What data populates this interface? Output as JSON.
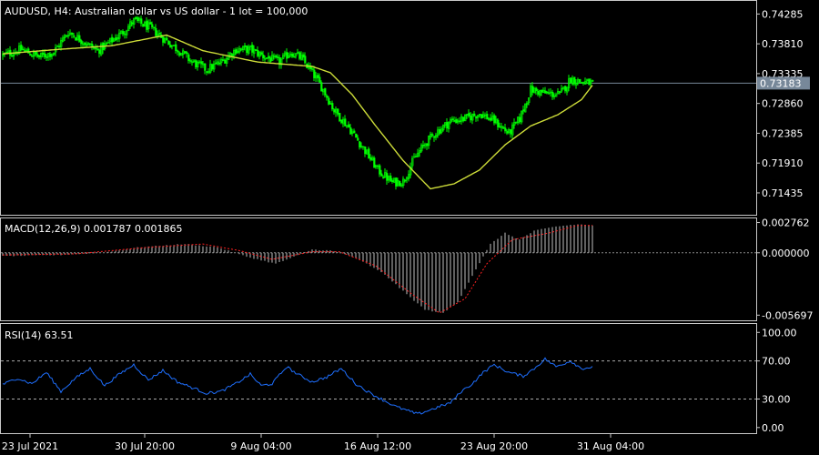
{
  "symbol_info": "AUDUSD, H4:  Australian dollar vs US dollar - 1 lot = 100,000",
  "colors": {
    "background": "#000000",
    "candles": "#00ff00",
    "moving_average": "#cddc39",
    "grid_border": "#c8c8c8",
    "price_line": "#778899",
    "macd_histogram": "#c0c0c0",
    "macd_signal": "#ff2020",
    "rsi_line": "#1e6fff",
    "text": "#ffffff"
  },
  "chart_data": [
    {
      "type": "candlestick",
      "title": "AUDUSD, H4:  Australian dollar vs US dollar - 1 lot = 100,000",
      "ylim": [
        0.7113,
        0.7445
      ],
      "y_ticks": [
        "0.74285",
        "0.73810",
        "0.73335",
        "0.72860",
        "0.72385",
        "0.71910",
        "0.71435"
      ],
      "y_tick_values": [
        0.74285,
        0.7381,
        0.73335,
        0.7286,
        0.72385,
        0.7191,
        0.71435
      ],
      "current_price_label": "0.73183",
      "current_price": 0.73183,
      "close_anchors": [
        [
          0,
          0.7363
        ],
        [
          10,
          0.7372
        ],
        [
          20,
          0.736
        ],
        [
          28,
          0.7368
        ],
        [
          36,
          0.74
        ],
        [
          44,
          0.7385
        ],
        [
          52,
          0.737
        ],
        [
          58,
          0.7382
        ],
        [
          66,
          0.74
        ],
        [
          72,
          0.7418
        ],
        [
          80,
          0.7408
        ],
        [
          88,
          0.739
        ],
        [
          96,
          0.7372
        ],
        [
          104,
          0.7352
        ],
        [
          112,
          0.734
        ],
        [
          120,
          0.7352
        ],
        [
          128,
          0.7372
        ],
        [
          136,
          0.7372
        ],
        [
          144,
          0.736
        ],
        [
          152,
          0.7352
        ],
        [
          158,
          0.7368
        ],
        [
          164,
          0.7358
        ],
        [
          170,
          0.7335
        ],
        [
          176,
          0.7308
        ],
        [
          182,
          0.7275
        ],
        [
          190,
          0.7248
        ],
        [
          198,
          0.7215
        ],
        [
          206,
          0.718
        ],
        [
          214,
          0.716
        ],
        [
          220,
          0.7162
        ],
        [
          226,
          0.7198
        ],
        [
          232,
          0.7222
        ],
        [
          238,
          0.724
        ],
        [
          246,
          0.7258
        ],
        [
          254,
          0.7262
        ],
        [
          262,
          0.727
        ],
        [
          270,
          0.7258
        ],
        [
          278,
          0.7238
        ],
        [
          284,
          0.7262
        ],
        [
          290,
          0.7308
        ],
        [
          298,
          0.7302
        ],
        [
          306,
          0.73
        ],
        [
          312,
          0.7325
        ],
        [
          318,
          0.732
        ],
        [
          324,
          0.7318
        ]
      ],
      "ma_anchors": [
        [
          0,
          0.7365
        ],
        [
          30,
          0.7372
        ],
        [
          60,
          0.7378
        ],
        [
          90,
          0.7395
        ],
        [
          110,
          0.737
        ],
        [
          140,
          0.7352
        ],
        [
          170,
          0.7345
        ],
        [
          180,
          0.7335
        ],
        [
          192,
          0.73
        ],
        [
          205,
          0.725
        ],
        [
          220,
          0.7195
        ],
        [
          235,
          0.715
        ],
        [
          248,
          0.7158
        ],
        [
          262,
          0.718
        ],
        [
          276,
          0.722
        ],
        [
          290,
          0.725
        ],
        [
          305,
          0.7268
        ],
        [
          318,
          0.7292
        ],
        [
          324,
          0.7315
        ]
      ],
      "bars": 325,
      "x_tick_labels": [
        "23 Jul 2021",
        "30 Jul 20:00",
        "9 Aug 04:00",
        "16 Aug 12:00",
        "23 Aug 20:00",
        "31 Aug 04:00"
      ],
      "x_tick_bars": [
        15,
        78,
        142,
        206,
        270,
        334
      ]
    },
    {
      "type": "bar",
      "title": "MACD(12,26,9) 0.001787 0.001865",
      "ylim": [
        -0.00592,
        0.00289
      ],
      "y_ticks": [
        "0.002762",
        "0.000000",
        "-0.005697"
      ],
      "y_tick_values": [
        0.002762,
        0.0,
        -0.005697
      ],
      "macd_anchors": [
        [
          0,
          -0.0003
        ],
        [
          30,
          -0.0002
        ],
        [
          55,
          0.0
        ],
        [
          75,
          0.0005
        ],
        [
          100,
          0.0008
        ],
        [
          118,
          0.0005
        ],
        [
          135,
          -0.0004
        ],
        [
          150,
          -0.001
        ],
        [
          158,
          -0.0005
        ],
        [
          170,
          0.0003
        ],
        [
          180,
          0.0002
        ],
        [
          190,
          -0.0002
        ],
        [
          200,
          -0.001
        ],
        [
          210,
          -0.002
        ],
        [
          220,
          -0.0035
        ],
        [
          232,
          -0.0052
        ],
        [
          242,
          -0.0055
        ],
        [
          250,
          -0.0045
        ],
        [
          260,
          -0.0015
        ],
        [
          268,
          0.0008
        ],
        [
          276,
          0.0018
        ],
        [
          284,
          0.0012
        ],
        [
          292,
          0.002
        ],
        [
          304,
          0.0024
        ],
        [
          316,
          0.0026
        ],
        [
          325,
          0.0025
        ]
      ],
      "signal_anchors": [
        [
          0,
          -0.0002
        ],
        [
          40,
          -0.0001
        ],
        [
          80,
          0.0005
        ],
        [
          110,
          0.0008
        ],
        [
          130,
          0.0002
        ],
        [
          148,
          -0.0006
        ],
        [
          170,
          0.0001
        ],
        [
          185,
          0.0001
        ],
        [
          205,
          -0.0012
        ],
        [
          225,
          -0.0038
        ],
        [
          240,
          -0.0055
        ],
        [
          254,
          -0.0042
        ],
        [
          266,
          -0.001
        ],
        [
          280,
          0.0012
        ],
        [
          300,
          0.0018
        ],
        [
          316,
          0.0025
        ],
        [
          325,
          0.0025
        ]
      ]
    },
    {
      "type": "line",
      "title": "RSI(14) 63.51",
      "ylim": [
        -4,
        106
      ],
      "y_ticks": [
        "100.00",
        "70.00",
        "30.00",
        "0.00"
      ],
      "y_tick_values": [
        100,
        70,
        30,
        0
      ],
      "levels": [
        70,
        30
      ],
      "rsi_anchors": [
        [
          0,
          45
        ],
        [
          8,
          52
        ],
        [
          16,
          46
        ],
        [
          24,
          58
        ],
        [
          32,
          38
        ],
        [
          40,
          52
        ],
        [
          48,
          62
        ],
        [
          56,
          44
        ],
        [
          64,
          56
        ],
        [
          72,
          66
        ],
        [
          80,
          50
        ],
        [
          88,
          60
        ],
        [
          96,
          48
        ],
        [
          104,
          42
        ],
        [
          112,
          36
        ],
        [
          120,
          38
        ],
        [
          128,
          46
        ],
        [
          136,
          56
        ],
        [
          142,
          44
        ],
        [
          148,
          46
        ],
        [
          156,
          64
        ],
        [
          162,
          56
        ],
        [
          170,
          48
        ],
        [
          178,
          53
        ],
        [
          186,
          62
        ],
        [
          194,
          46
        ],
        [
          202,
          36
        ],
        [
          210,
          28
        ],
        [
          216,
          22
        ],
        [
          222,
          18
        ],
        [
          228,
          14
        ],
        [
          234,
          18
        ],
        [
          240,
          22
        ],
        [
          246,
          26
        ],
        [
          252,
          38
        ],
        [
          258,
          46
        ],
        [
          264,
          58
        ],
        [
          270,
          66
        ],
        [
          278,
          58
        ],
        [
          286,
          54
        ],
        [
          292,
          62
        ],
        [
          298,
          72
        ],
        [
          304,
          64
        ],
        [
          312,
          70
        ],
        [
          318,
          62
        ],
        [
          324,
          63.5
        ]
      ]
    }
  ]
}
